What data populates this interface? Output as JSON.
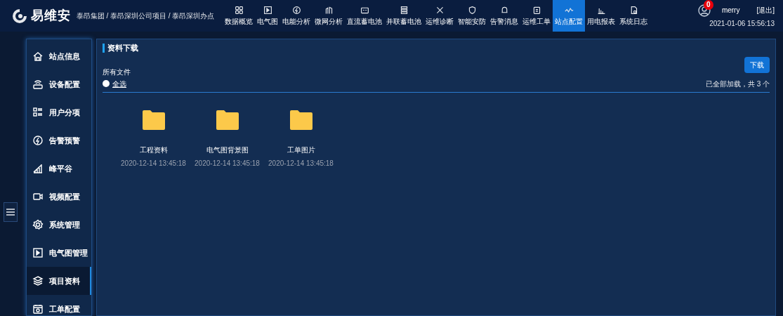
{
  "header": {
    "logo_text": "易维安",
    "breadcrumb": "泰昂集团 / 泰昂深圳公司项目 / 泰昂深圳办点",
    "nav": [
      {
        "label": "数据概览",
        "selected": false
      },
      {
        "label": "电气图",
        "selected": false
      },
      {
        "label": "电能分析",
        "selected": false
      },
      {
        "label": "微网分析",
        "selected": false
      },
      {
        "label": "直流蓄电池",
        "selected": false
      },
      {
        "label": "并联蓄电池",
        "selected": false
      },
      {
        "label": "运维诊断",
        "selected": false
      },
      {
        "label": "智能安防",
        "selected": false
      },
      {
        "label": "告警消息",
        "selected": false
      },
      {
        "label": "运维工单",
        "selected": false
      },
      {
        "label": "站点配置",
        "selected": true
      },
      {
        "label": "用电报表",
        "selected": false
      },
      {
        "label": "系统日志",
        "selected": false
      }
    ],
    "notification_count": "0",
    "user": "merry",
    "logout": "[退出]",
    "datetime": "2021-01-06 15:56:13"
  },
  "sidebar": {
    "items": [
      {
        "label": "站点信息",
        "selected": false
      },
      {
        "label": "设备配置",
        "selected": false
      },
      {
        "label": "用户分项",
        "selected": false
      },
      {
        "label": "告警预警",
        "selected": false
      },
      {
        "label": "峰平谷",
        "selected": false
      },
      {
        "label": "视频配置",
        "selected": false
      },
      {
        "label": "系统管理",
        "selected": false
      },
      {
        "label": "电气图管理",
        "selected": false
      },
      {
        "label": "项目资料",
        "selected": true
      },
      {
        "label": "工单配置",
        "selected": false
      }
    ]
  },
  "main": {
    "title": "资料下载",
    "section_label": "所有文件",
    "select_all": {
      "label": "全选",
      "checked": false
    },
    "download_button": "下载",
    "status": "已全部加载，共 3 个",
    "files": [
      {
        "name": "工程资料",
        "date": "2020-12-14 13:45:18"
      },
      {
        "name": "电气图背景图",
        "date": "2020-12-14 13:45:18"
      },
      {
        "name": "工单图片",
        "date": "2020-12-14 13:45:18"
      }
    ]
  }
}
